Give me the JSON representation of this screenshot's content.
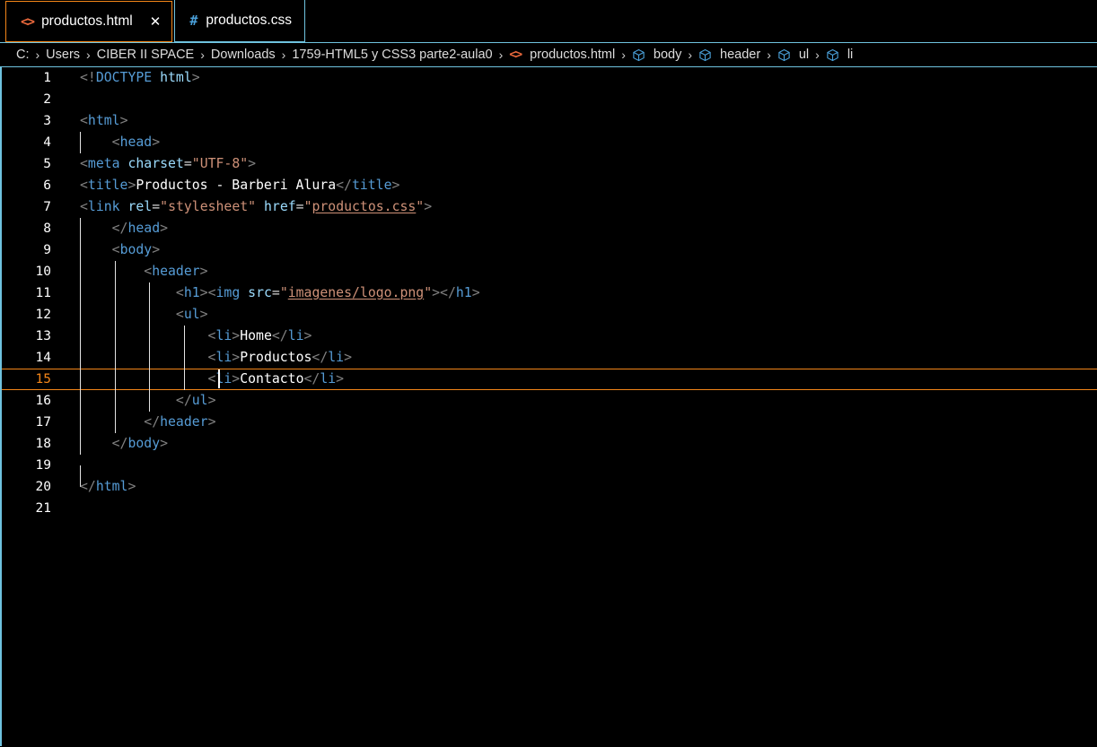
{
  "window": {
    "app": "Visual Studio Code",
    "theme": "High Contrast Dark"
  },
  "tabs": [
    {
      "label": "productos.html",
      "icon": "html5-icon",
      "icon_glyph": "<>",
      "active": true,
      "close_glyph": "✕"
    },
    {
      "label": "productos.css",
      "icon": "css-icon",
      "icon_glyph": "#",
      "active": false,
      "close_glyph": ""
    }
  ],
  "breadcrumb": {
    "separator": "›",
    "items": [
      {
        "label": "C:",
        "icon": ""
      },
      {
        "label": "Users",
        "icon": ""
      },
      {
        "label": "CIBER II SPACE",
        "icon": ""
      },
      {
        "label": "Downloads",
        "icon": ""
      },
      {
        "label": "1759-HTML5 y CSS3 parte2-aula0",
        "icon": ""
      },
      {
        "label": "productos.html",
        "icon": "html5-icon"
      },
      {
        "label": "body",
        "icon": "symbol-cube-icon"
      },
      {
        "label": "header",
        "icon": "symbol-cube-icon"
      },
      {
        "label": "ul",
        "icon": "symbol-cube-icon"
      },
      {
        "label": "li",
        "icon": "symbol-cube-icon"
      }
    ]
  },
  "editor": {
    "language": "html",
    "current_line": 15,
    "cursor_column": 17,
    "total_lines": 21,
    "lines": [
      {
        "n": 1,
        "text": "<!DOCTYPE html>"
      },
      {
        "n": 2,
        "text": ""
      },
      {
        "n": 3,
        "text": "<html>"
      },
      {
        "n": 4,
        "text": "    <head>"
      },
      {
        "n": 5,
        "text": "<meta charset=\"UTF-8\">"
      },
      {
        "n": 6,
        "text": "<title>Productos - Barberi Alura</title>"
      },
      {
        "n": 7,
        "text": "<link rel=\"stylesheet\" href=\"productos.css\">"
      },
      {
        "n": 8,
        "text": "    </head>"
      },
      {
        "n": 9,
        "text": "    <body>"
      },
      {
        "n": 10,
        "text": "        <header>"
      },
      {
        "n": 11,
        "text": "            <h1><img src=\"imagenes/logo.png\"></h1>"
      },
      {
        "n": 12,
        "text": "            <ul>"
      },
      {
        "n": 13,
        "text": "                <li>Home</li>"
      },
      {
        "n": 14,
        "text": "                <li>Productos</li>"
      },
      {
        "n": 15,
        "text": "                <li>Contacto</li>"
      },
      {
        "n": 16,
        "text": "            </ul>"
      },
      {
        "n": 17,
        "text": "        </header>"
      },
      {
        "n": 18,
        "text": "    </body>"
      },
      {
        "n": 19,
        "text": ""
      },
      {
        "n": 20,
        "text": "</html>"
      },
      {
        "n": 21,
        "text": ""
      }
    ],
    "links": [
      "productos.css",
      "imagenes/logo.png"
    ]
  },
  "colors": {
    "background": "#000000",
    "accent_orange": "#f38518",
    "accent_blue": "#6fc3df",
    "tag": "#569cd6",
    "attribute": "#9cdcfe",
    "string": "#ce9178",
    "punctuation": "#808080",
    "text": "#ffffff",
    "linenumber": "#ffffff",
    "current_linenumber": "#f38518"
  }
}
